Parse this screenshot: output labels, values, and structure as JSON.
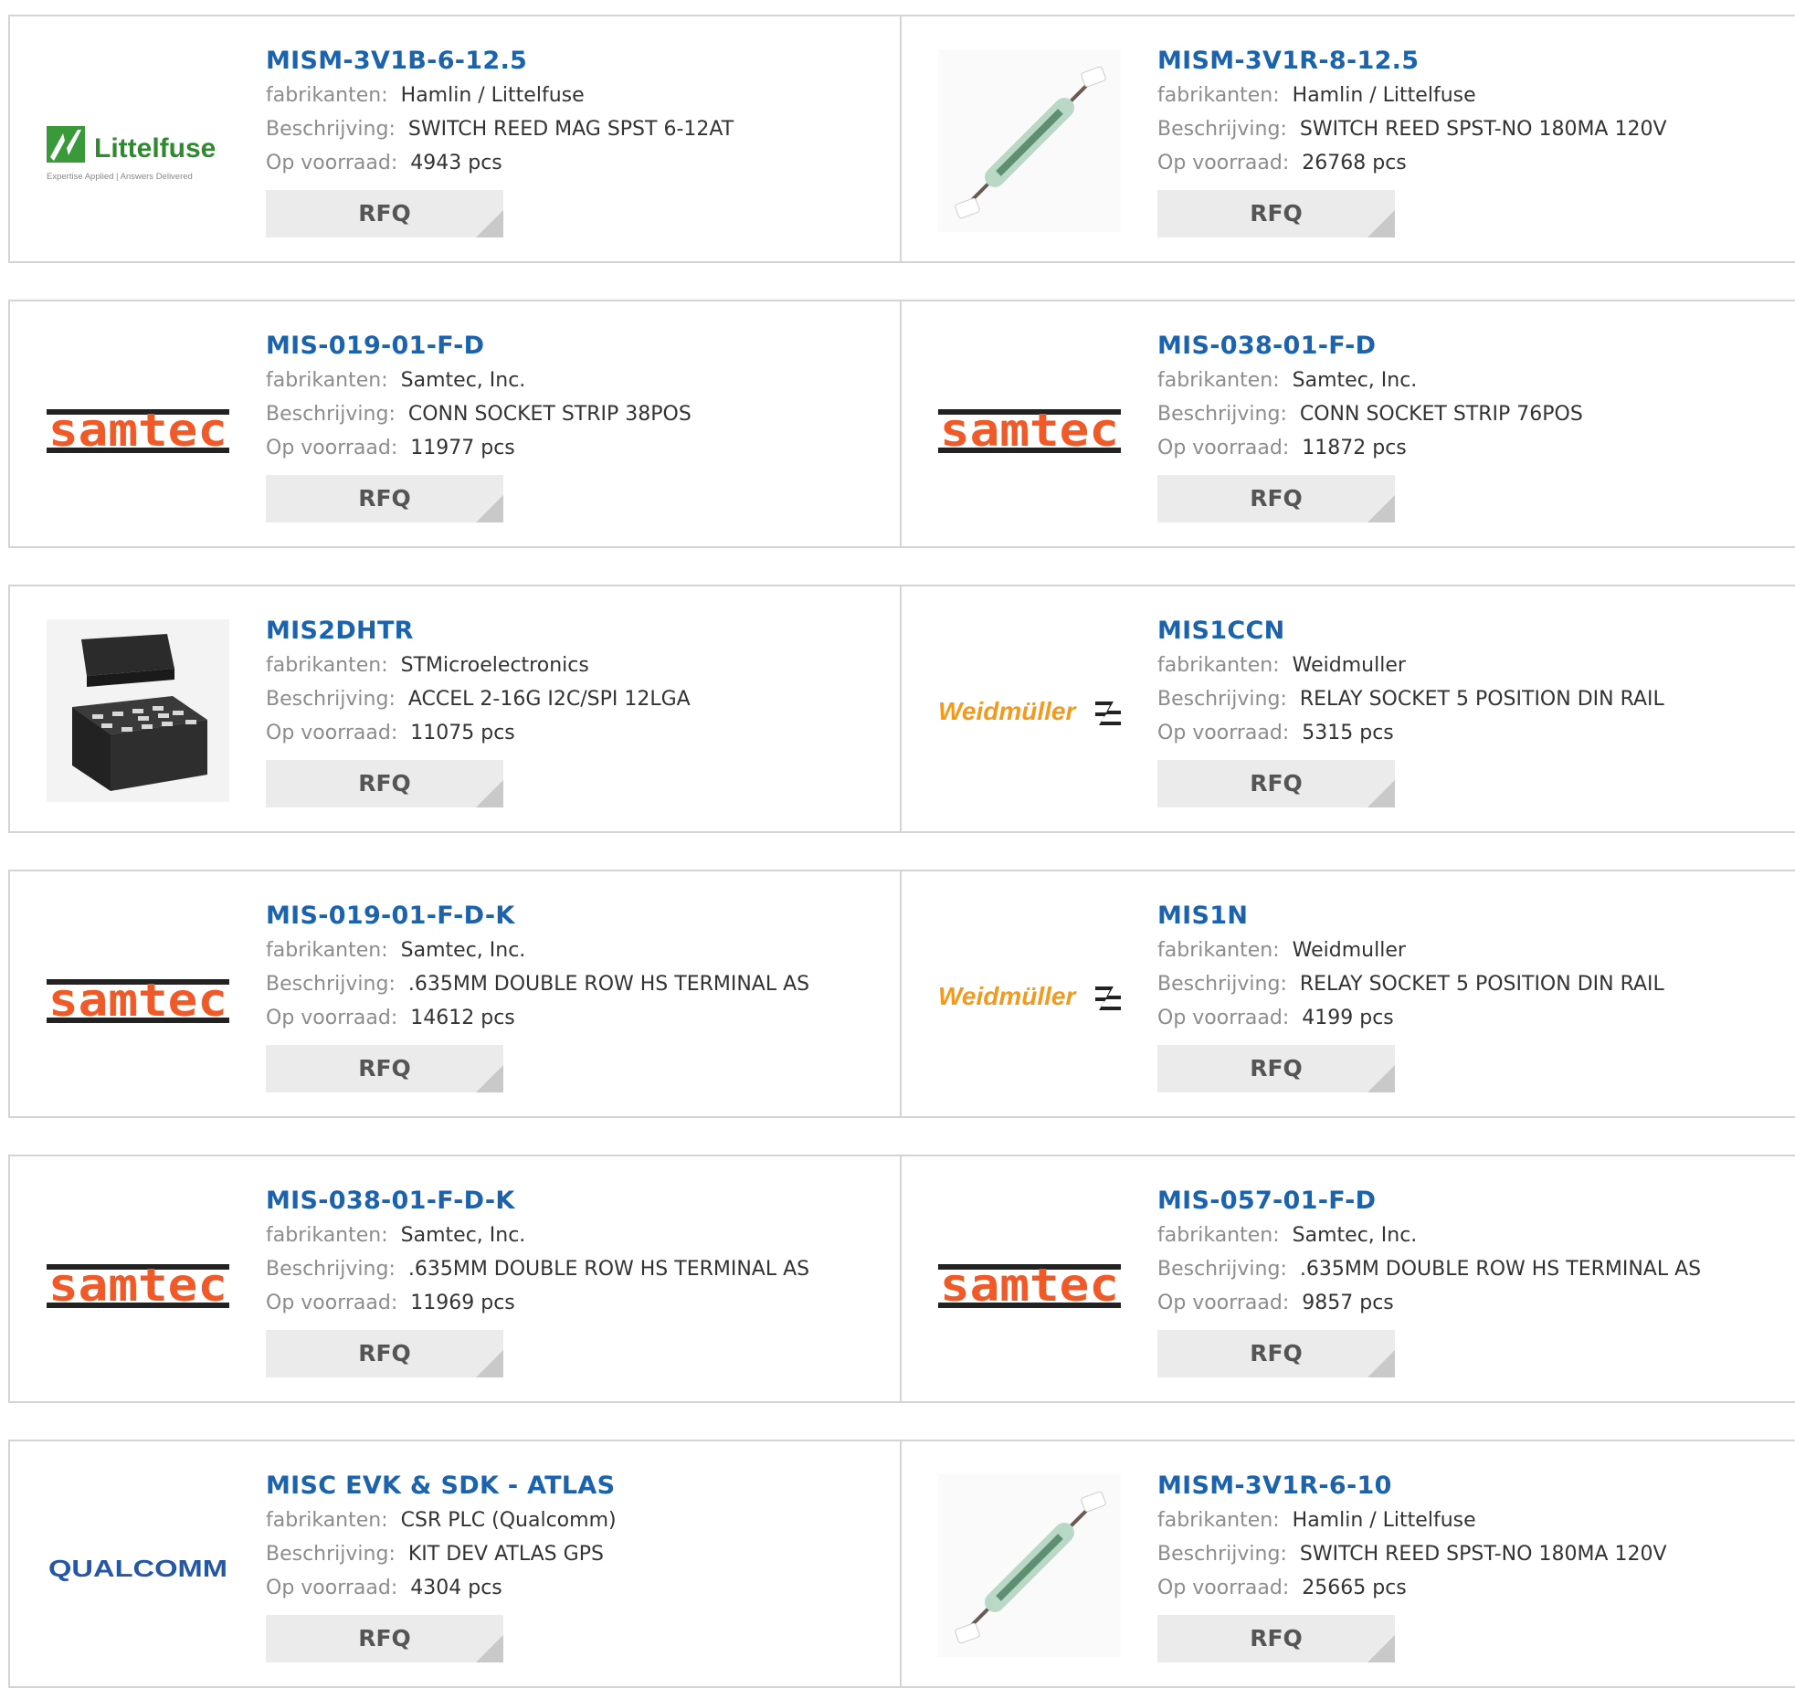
{
  "labels": {
    "manufacturer": "fabrikanten:",
    "description": "Beschrijving:",
    "stock": "Op voorraad:",
    "rfq": "RFQ"
  },
  "colors": {
    "part_link": "#1b63ad",
    "label": "#8c8c8c",
    "value": "#333333",
    "rfq_bg": "#ebebeb"
  },
  "products": [
    {
      "part": "MISM-3V1B-6-12.5",
      "manufacturer": "Hamlin / Littelfuse",
      "description": "SWITCH REED MAG SPST 6-12AT",
      "stock": "4943 pcs",
      "image": "littelfuse-logo",
      "logo_text": "Littelfuse",
      "logo_tagline": "Expertise Applied | Answers Delivered"
    },
    {
      "part": "MISM-3V1R-8-12.5",
      "manufacturer": "Hamlin / Littelfuse",
      "description": "SWITCH REED SPST-NO 180MA 120V",
      "stock": "26768 pcs",
      "image": "reed-switch-photo"
    },
    {
      "part": "MIS-019-01-F-D",
      "manufacturer": "Samtec, Inc.",
      "description": "CONN SOCKET STRIP 38POS",
      "stock": "11977 pcs",
      "image": "samtec-logo",
      "logo_text": "samtec"
    },
    {
      "part": "MIS-038-01-F-D",
      "manufacturer": "Samtec, Inc.",
      "description": "CONN SOCKET STRIP 76POS",
      "stock": "11872 pcs",
      "image": "samtec-logo",
      "logo_text": "samtec"
    },
    {
      "part": "MIS2DHTR",
      "manufacturer": "STMicroelectronics",
      "description": "ACCEL 2-16G I2C/SPI 12LGA",
      "stock": "11075 pcs",
      "image": "lga-chip-photo"
    },
    {
      "part": "MIS1CCN",
      "manufacturer": "Weidmuller",
      "description": "RELAY SOCKET 5 POSITION DIN RAIL",
      "stock": "5315 pcs",
      "image": "weidmuller-logo",
      "logo_text": "Weidmüller"
    },
    {
      "part": "MIS-019-01-F-D-K",
      "manufacturer": "Samtec, Inc.",
      "description": ".635MM DOUBLE ROW HS TERMINAL AS",
      "stock": "14612 pcs",
      "image": "samtec-logo",
      "logo_text": "samtec"
    },
    {
      "part": "MIS1N",
      "manufacturer": "Weidmuller",
      "description": "RELAY SOCKET 5 POSITION DIN RAIL",
      "stock": "4199 pcs",
      "image": "weidmuller-logo",
      "logo_text": "Weidmüller"
    },
    {
      "part": "MIS-038-01-F-D-K",
      "manufacturer": "Samtec, Inc.",
      "description": ".635MM DOUBLE ROW HS TERMINAL AS",
      "stock": "11969 pcs",
      "image": "samtec-logo",
      "logo_text": "samtec"
    },
    {
      "part": "MIS-057-01-F-D",
      "manufacturer": "Samtec, Inc.",
      "description": ".635MM DOUBLE ROW HS TERMINAL AS",
      "stock": "9857 pcs",
      "image": "samtec-logo",
      "logo_text": "samtec"
    },
    {
      "part": "MISC EVK & SDK - ATLAS",
      "manufacturer": "CSR PLC (Qualcomm)",
      "description": "KIT DEV ATLAS GPS",
      "stock": "4304 pcs",
      "image": "qualcomm-logo",
      "logo_text": "QUALCOMM"
    },
    {
      "part": "MISM-3V1R-6-10",
      "manufacturer": "Hamlin / Littelfuse",
      "description": "SWITCH REED SPST-NO 180MA 120V",
      "stock": "25665 pcs",
      "image": "reed-switch-photo"
    }
  ]
}
